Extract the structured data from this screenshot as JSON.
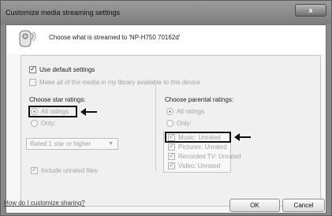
{
  "window": {
    "title": "Customize media streaming settings",
    "close_label": "x"
  },
  "header": {
    "text": "Choose what is streamed to 'NP-H750 70162d'",
    "icon": "media-device-icon"
  },
  "options": {
    "use_default": {
      "label": "Use default settings",
      "checked": true
    },
    "make_all": {
      "label": "Make all of the media in my library available to this device",
      "checked": false,
      "disabled": true
    }
  },
  "star_ratings": {
    "title": "Choose star ratings:",
    "all_ratings": "All ratings",
    "only": "Only:",
    "dropdown_value": "Rated 1 star or higher",
    "include_unrated": "Include unrated files"
  },
  "parental_ratings": {
    "title": "Choose parental ratings:",
    "all_ratings": "All ratings",
    "only": "Only:",
    "items": [
      {
        "label": "Music: Unrated",
        "checked": true
      },
      {
        "label": "Pictures: Unrated",
        "checked": true
      },
      {
        "label": "Recorded TV: Unrated",
        "checked": true
      },
      {
        "label": "Video: Unrated",
        "checked": true
      }
    ]
  },
  "footer": {
    "help_link": "How do I customize sharing?",
    "ok": "OK",
    "cancel": "Cancel"
  },
  "colors": {
    "window_frame": "#8a8a8a",
    "dialog_bg": "#f6f6f6",
    "annotation": "#111111"
  }
}
